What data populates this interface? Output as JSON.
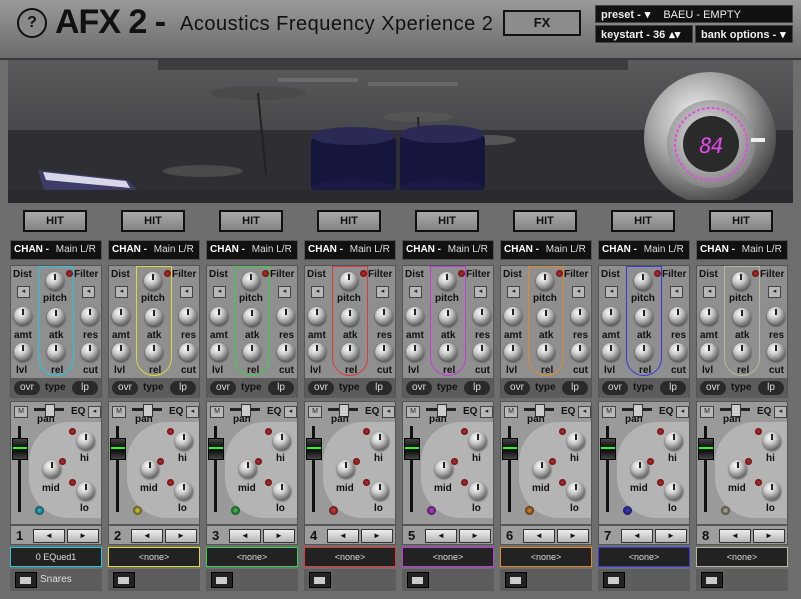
{
  "header": {
    "help_label": "?",
    "logo": "AFX 2 -",
    "subtitle": "Acoustics Frequency Xperience 2",
    "fx_label": "FX",
    "preset_label": "preset -",
    "preset_value": "BAEU - EMPTY",
    "keystart_label": "keystart - 36",
    "bank_options_label": "bank options -"
  },
  "dial": {
    "value": "84"
  },
  "strip_labels": {
    "hit": "HIT",
    "chan": "CHAN -",
    "chan_value": "Main L/R",
    "dist": "Dist",
    "filter": "Filter",
    "pitch": "pitch",
    "amt": "amt",
    "atk": "atk",
    "res": "res",
    "lvl": "lvl",
    "rel": "rel",
    "cut": "cut",
    "ovr": "ovr",
    "type": "type",
    "lp": "lp",
    "m": "M",
    "pan": "pan",
    "eq": "EQ",
    "hi": "hi",
    "mid": "mid",
    "lo": "lo",
    "prev": "◄",
    "next": "►"
  },
  "channels": [
    {
      "num": "1",
      "color": "#27c7e0",
      "name": "0 EQued1",
      "group": "Snares"
    },
    {
      "num": "2",
      "color": "#e0d83a",
      "name": "<none>",
      "group": ""
    },
    {
      "num": "3",
      "color": "#36d24a",
      "name": "<none>",
      "group": ""
    },
    {
      "num": "4",
      "color": "#e03a3a",
      "name": "<none>",
      "group": ""
    },
    {
      "num": "5",
      "color": "#c23ae0",
      "name": "<none>",
      "group": ""
    },
    {
      "num": "6",
      "color": "#e08a2a",
      "name": "<none>",
      "group": ""
    },
    {
      "num": "7",
      "color": "#3a3ae0",
      "name": "<none>",
      "group": ""
    },
    {
      "num": "8",
      "color": "#b8b89a",
      "name": "<none>",
      "group": ""
    }
  ]
}
